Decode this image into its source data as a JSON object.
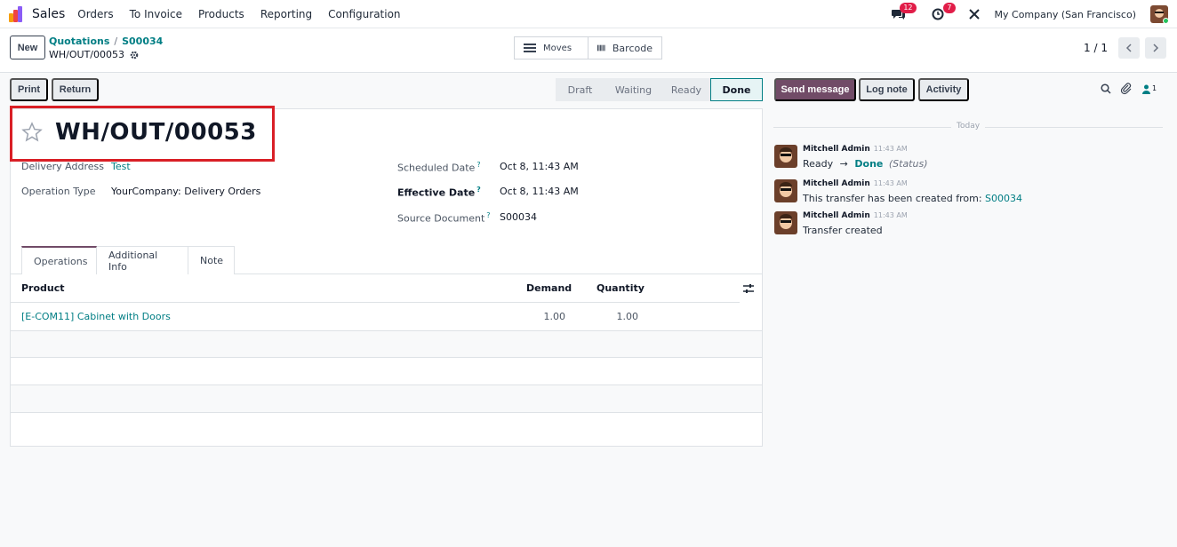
{
  "nav": {
    "app_name": "Sales",
    "items": [
      "Orders",
      "To Invoice",
      "Products",
      "Reporting",
      "Configuration"
    ],
    "messages_badge": "12",
    "activities_badge": "7",
    "company": "My Company (San Francisco)"
  },
  "control": {
    "new_label": "New",
    "breadcrumb_parent": "Quotations",
    "breadcrumb_separator": "/",
    "breadcrumb_order": "S00034",
    "breadcrumb_current": "WH/OUT/00053",
    "moves_label": "Moves",
    "barcode_label": "Barcode",
    "pager": "1 / 1"
  },
  "actions": {
    "print_label": "Print",
    "return_label": "Return"
  },
  "statusbar": [
    "Draft",
    "Waiting",
    "Ready",
    "Done"
  ],
  "record": {
    "title": "WH/OUT/00053",
    "delivery_address_label": "Delivery Address",
    "delivery_address_value": "Test",
    "operation_type_label": "Operation Type",
    "operation_type_value": "YourCompany: Delivery Orders",
    "scheduled_date_label": "Scheduled Date",
    "scheduled_date_value": "Oct 8, 11:43 AM",
    "effective_date_label": "Effective Date",
    "effective_date_value": "Oct 8, 11:43 AM",
    "source_document_label": "Source Document",
    "source_document_value": "S00034",
    "help_mark": "?"
  },
  "tabs": [
    "Operations",
    "Additional Info",
    "Note"
  ],
  "table": {
    "headers": {
      "product": "Product",
      "demand": "Demand",
      "quantity": "Quantity"
    },
    "rows": [
      {
        "product": "[E-COM11] Cabinet with Doors",
        "demand": "1.00",
        "quantity": "1.00"
      }
    ]
  },
  "chatter": {
    "send_message_label": "Send message",
    "log_note_label": "Log note",
    "activity_label": "Activity",
    "followers_count": "1",
    "today_label": "Today",
    "messages": [
      {
        "author": "Mitchell Admin",
        "time": "11:43 AM",
        "from": "Ready",
        "arrow": "→",
        "to": "Done",
        "field": "(Status)"
      },
      {
        "author": "Mitchell Admin",
        "time": "11:43 AM",
        "text": "This transfer has been created from:",
        "link": "S00034"
      },
      {
        "author": "Mitchell Admin",
        "time": "11:43 AM",
        "text": "Transfer created"
      }
    ]
  },
  "colors": {
    "brand": "#714b67",
    "link": "#017e84",
    "highlight_box": "#d91f26"
  }
}
